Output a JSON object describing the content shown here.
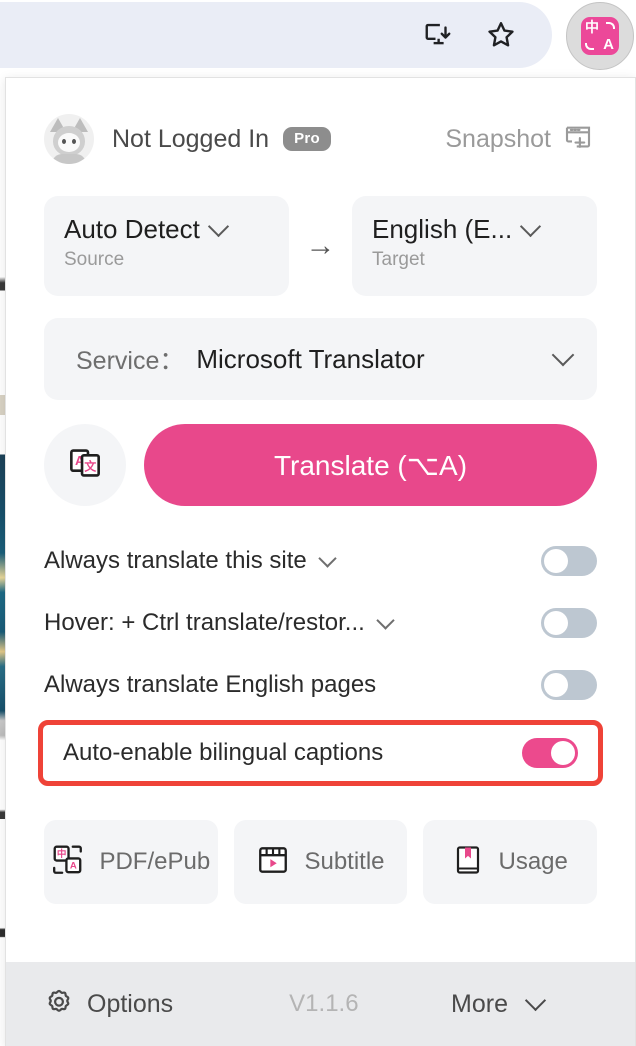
{
  "browser_toolbar": {
    "install_icon": "install-app-icon",
    "bookmark_icon": "star-icon",
    "extension_icon": "immersive-translate-icon",
    "extension_glyph_cn": "中",
    "extension_glyph_en": "A"
  },
  "account": {
    "name": "Not Logged In",
    "badge": "Pro",
    "avatar_icon": "user-avatar",
    "snapshot_label": "Snapshot",
    "snapshot_icon": "new-window-plus-icon"
  },
  "languages": {
    "source": {
      "value": "Auto Detect",
      "sub": "Source"
    },
    "target": {
      "value": "English (E...",
      "sub": "Target"
    },
    "arrow": "→"
  },
  "service": {
    "label": "Service：",
    "value": "Microsoft Translator"
  },
  "action": {
    "swap_icon": "translate-cards-icon",
    "translate_label": "Translate (⌥A)"
  },
  "options": [
    {
      "label": "Always translate this site",
      "has_chevron": true,
      "toggle": "off"
    },
    {
      "label": "Hover:  + Ctrl translate/restor...",
      "has_chevron": true,
      "toggle": "off"
    },
    {
      "label": "Always translate English pages",
      "has_chevron": false,
      "toggle": "off"
    },
    {
      "label": "Auto-enable bilingual captions",
      "has_chevron": false,
      "toggle": "on",
      "highlighted": true
    }
  ],
  "quick_links": [
    {
      "label": "PDF/ePub",
      "icon": "pdf-epub-icon"
    },
    {
      "label": "Subtitle",
      "icon": "subtitle-icon"
    },
    {
      "label": "Usage",
      "icon": "usage-book-icon"
    }
  ],
  "footer": {
    "options_label": "Options",
    "options_icon": "gear-icon",
    "version": "V1.1.6",
    "more_label": "More"
  },
  "colors": {
    "accent_pink": "#e8488b",
    "toggle_on": "#ec4a8d",
    "toggle_off": "#bdc7d1",
    "highlight_red": "#ef4338",
    "panel_gray": "#f4f5f7",
    "footer_gray": "#e9eaec"
  }
}
